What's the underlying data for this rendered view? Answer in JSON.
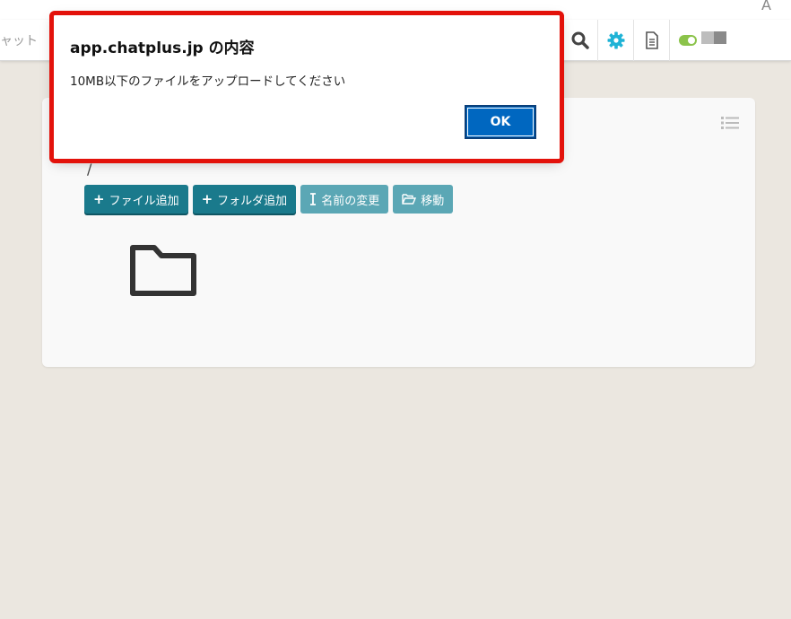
{
  "browser": {
    "corner_glyph": "A"
  },
  "toolbar": {
    "chat_label": "ャット",
    "icons": [
      "search-icon",
      "gear-icon",
      "document-icon",
      "toggle-icon"
    ],
    "colors": {
      "gear": "#1fb3d6",
      "toggle_on": "#8bc34a"
    }
  },
  "panel": {
    "path": "/",
    "buttons": {
      "add_file": "ファイル追加",
      "add_folder": "フォルダ追加",
      "rename": "名前の変更",
      "move": "移動"
    }
  },
  "dialog": {
    "title": "app.chatplus.jp の内容",
    "message": "10MB以下のファイルをアップロードしてください",
    "ok_label": "OK",
    "highlight_color": "#e3120b"
  }
}
